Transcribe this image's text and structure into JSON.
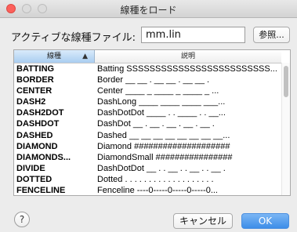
{
  "window": {
    "title": "線種をロード"
  },
  "file": {
    "label": "アクティブな線種ファイル:",
    "value": "mm.lin",
    "browse_label": "参照..."
  },
  "table": {
    "col_name": "線種",
    "col_desc": "説明",
    "sort_icon": "▲",
    "rows": [
      {
        "name": "BATTING",
        "desc": "Batting SSSSSSSSSSSSSSSSSSSSSSSSS..."
      },
      {
        "name": "BORDER",
        "desc": "Border __ __ . __ __ . __ __ ."
      },
      {
        "name": "CENTER",
        "desc": "Center ____ _ ____ _ ____ _ ..."
      },
      {
        "name": "DASH2",
        "desc": "DashLong ____ ____ ____ ___..."
      },
      {
        "name": "DASH2DOT",
        "desc": "DashDotDot ____ . . ____ . . __..."
      },
      {
        "name": "DASHDOT",
        "desc": "DashDot __ . __ . __ . __ . __ ."
      },
      {
        "name": "DASHED",
        "desc": "Dashed __ __ __ __ __ __ __ __..."
      },
      {
        "name": "DIAMOND",
        "desc": "Diamond ####################"
      },
      {
        "name": "DIAMONDS...",
        "desc": "DiamondSmall ################"
      },
      {
        "name": "DIVIDE",
        "desc": "DashDotDot __ . . __ . . __ . . __ ."
      },
      {
        "name": "DOTTED",
        "desc": "Dotted . . . . . . . . . . . . . . . . . . ."
      },
      {
        "name": "FENCELINE",
        "desc": "Fenceline ----0-----0-----0-----0..."
      }
    ]
  },
  "buttons": {
    "help": "?",
    "cancel": "キャンセル",
    "ok": "OK"
  }
}
